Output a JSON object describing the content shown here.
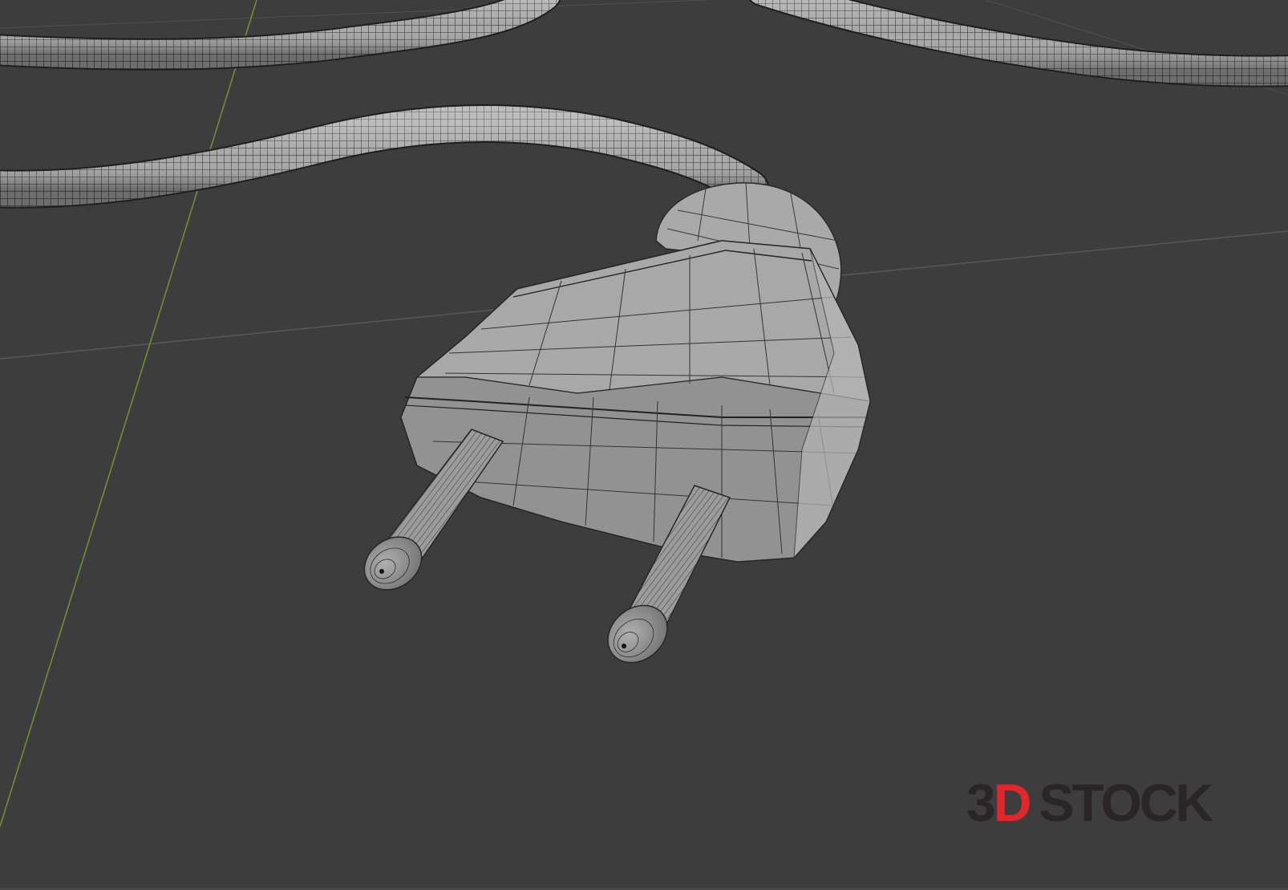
{
  "viewport": {
    "background_color": "#3d3d3d",
    "mesh_color": "#a3a3a3",
    "wire_color": "#1f1f1f",
    "grid_color": "#575757",
    "y_axis_color": "#6f8f32"
  },
  "watermark": {
    "part_3": "3",
    "part_d": "D",
    "part_stock": "STOCK",
    "accent_color": "#e3262b",
    "dark_color": "#2a2526"
  }
}
